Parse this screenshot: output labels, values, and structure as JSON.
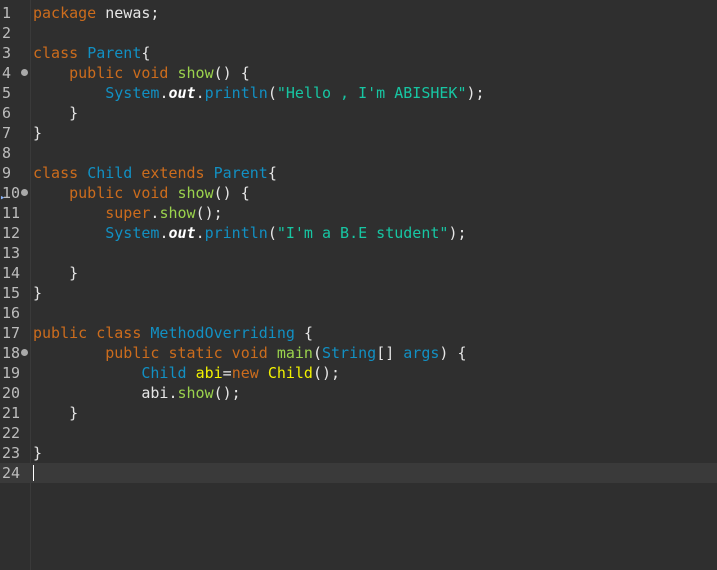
{
  "editor": {
    "current_line": 24,
    "lines": [
      {
        "n": "1",
        "tokens": [
          {
            "t": "package ",
            "c": "kw"
          },
          {
            "t": "newas;",
            "c": "pl"
          }
        ]
      },
      {
        "n": "2",
        "tokens": []
      },
      {
        "n": "3",
        "tokens": [
          {
            "t": "class ",
            "c": "kw"
          },
          {
            "t": "Parent",
            "c": "ty"
          },
          {
            "t": "{",
            "c": "pl"
          }
        ]
      },
      {
        "n": "4",
        "fold": true,
        "tokens": [
          {
            "t": "    public void ",
            "c": "kw"
          },
          {
            "t": "show",
            "c": "fn"
          },
          {
            "t": "() {",
            "c": "pl"
          }
        ]
      },
      {
        "n": "5",
        "tokens": [
          {
            "t": "        System",
            "c": "ty"
          },
          {
            "t": ".",
            "c": "pl"
          },
          {
            "t": "out",
            "c": "fld"
          },
          {
            "t": ".",
            "c": "pl"
          },
          {
            "t": "println",
            "c": "ty"
          },
          {
            "t": "(",
            "c": "pl"
          },
          {
            "t": "\"Hello , I'm ABISHEK\"",
            "c": "st"
          },
          {
            "t": ");",
            "c": "pl"
          }
        ]
      },
      {
        "n": "6",
        "tokens": [
          {
            "t": "    }",
            "c": "pl"
          }
        ]
      },
      {
        "n": "7",
        "tokens": [
          {
            "t": "}",
            "c": "pl"
          }
        ]
      },
      {
        "n": "8",
        "tokens": []
      },
      {
        "n": "9",
        "tokens": [
          {
            "t": "class ",
            "c": "kw"
          },
          {
            "t": "Child ",
            "c": "ty"
          },
          {
            "t": "extends ",
            "c": "kw"
          },
          {
            "t": "Parent",
            "c": "ty"
          },
          {
            "t": "{",
            "c": "pl"
          }
        ]
      },
      {
        "n": "10",
        "fold": true,
        "marker": true,
        "tokens": [
          {
            "t": "    public void ",
            "c": "kw"
          },
          {
            "t": "show",
            "c": "fn"
          },
          {
            "t": "() {",
            "c": "pl"
          }
        ]
      },
      {
        "n": "11",
        "tokens": [
          {
            "t": "        super",
            "c": "kw"
          },
          {
            "t": ".",
            "c": "pl"
          },
          {
            "t": "show",
            "c": "fn"
          },
          {
            "t": "();",
            "c": "pl"
          }
        ]
      },
      {
        "n": "12",
        "tokens": [
          {
            "t": "        System",
            "c": "ty"
          },
          {
            "t": ".",
            "c": "pl"
          },
          {
            "t": "out",
            "c": "fld"
          },
          {
            "t": ".",
            "c": "pl"
          },
          {
            "t": "println",
            "c": "ty"
          },
          {
            "t": "(",
            "c": "pl"
          },
          {
            "t": "\"I'm a B.E student\"",
            "c": "st"
          },
          {
            "t": ");",
            "c": "pl"
          }
        ]
      },
      {
        "n": "13",
        "tokens": []
      },
      {
        "n": "14",
        "tokens": [
          {
            "t": "    }",
            "c": "pl"
          }
        ]
      },
      {
        "n": "15",
        "tokens": [
          {
            "t": "}",
            "c": "pl"
          }
        ]
      },
      {
        "n": "16",
        "tokens": []
      },
      {
        "n": "17",
        "tokens": [
          {
            "t": "public class ",
            "c": "kw"
          },
          {
            "t": "MethodOverriding ",
            "c": "ty"
          },
          {
            "t": "{",
            "c": "pl"
          }
        ]
      },
      {
        "n": "18",
        "fold": true,
        "tokens": [
          {
            "t": "        public static void ",
            "c": "kw"
          },
          {
            "t": "main",
            "c": "fn"
          },
          {
            "t": "(",
            "c": "pl"
          },
          {
            "t": "String",
            "c": "ty"
          },
          {
            "t": "[] ",
            "c": "pl"
          },
          {
            "t": "args",
            "c": "ty"
          },
          {
            "t": ") {",
            "c": "pl"
          }
        ]
      },
      {
        "n": "19",
        "tokens": [
          {
            "t": "            Child ",
            "c": "ty"
          },
          {
            "t": "abi",
            "c": "var"
          },
          {
            "t": "=",
            "c": "pl"
          },
          {
            "t": "new ",
            "c": "kw"
          },
          {
            "t": "Child",
            "c": "var"
          },
          {
            "t": "();",
            "c": "pl"
          }
        ]
      },
      {
        "n": "20",
        "tokens": [
          {
            "t": "            abi",
            "c": "pl"
          },
          {
            "t": ".",
            "c": "pl"
          },
          {
            "t": "show",
            "c": "fn"
          },
          {
            "t": "();",
            "c": "pl"
          }
        ]
      },
      {
        "n": "21",
        "tokens": [
          {
            "t": "    }",
            "c": "pl"
          }
        ]
      },
      {
        "n": "22",
        "tokens": []
      },
      {
        "n": "23",
        "tokens": [
          {
            "t": "}",
            "c": "pl"
          }
        ]
      },
      {
        "n": "24",
        "tokens": []
      }
    ]
  }
}
